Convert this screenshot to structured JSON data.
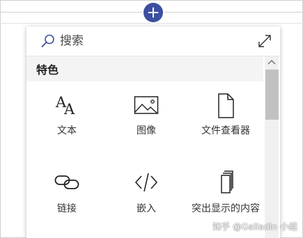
{
  "toolbar": {
    "add_button_icon": "plus-icon"
  },
  "search": {
    "placeholder": "搜索",
    "value": ""
  },
  "category": {
    "title": "特色"
  },
  "tiles": [
    {
      "label": "文本",
      "icon": "text-icon"
    },
    {
      "label": "图像",
      "icon": "image-icon"
    },
    {
      "label": "文件查看器",
      "icon": "file-icon"
    },
    {
      "label": "链接",
      "icon": "link-icon"
    },
    {
      "label": "嵌入",
      "icon": "code-icon"
    },
    {
      "label": "突出显示的内容",
      "icon": "copy-icon"
    }
  ],
  "watermark": {
    "text": "知乎 @Galladin 小组"
  },
  "colors": {
    "accent": "#3b4fa0",
    "header_bg": "#f4f4f4",
    "scrollbar_thumb": "#c1c1c1"
  }
}
